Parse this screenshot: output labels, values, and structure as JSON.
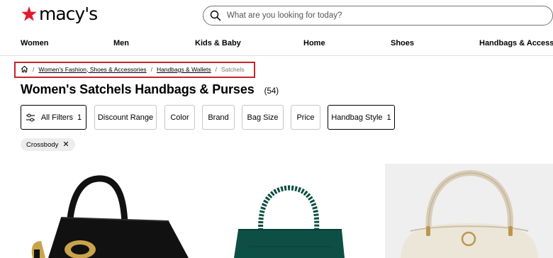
{
  "header": {
    "brand": "macy's",
    "search_placeholder": "What are you looking for today?"
  },
  "nav": [
    "Women",
    "Men",
    "Kids & Baby",
    "Home",
    "Shoes",
    "Handbags & Accessories"
  ],
  "breadcrumb": {
    "items": [
      "Women's Fashion, Shoes & Accessories",
      "Handbags & Wallets"
    ],
    "current": "Satchels"
  },
  "page": {
    "title": "Women's Satchels Handbags & Purses",
    "count": "(54)"
  },
  "filters": {
    "all_filters": "All Filters",
    "all_filters_count": "1",
    "discount_range": "Discount Range",
    "color": "Color",
    "brand": "Brand",
    "bag_size": "Bag Size",
    "price": "Price",
    "handbag_style": "Handbag Style",
    "handbag_style_count": "1"
  },
  "applied_filter": {
    "label": "Crossbody"
  },
  "colors": {
    "brand_red": "#e21a2c",
    "highlight_red": "#c8232c",
    "bag_green": "#0d4f44"
  }
}
